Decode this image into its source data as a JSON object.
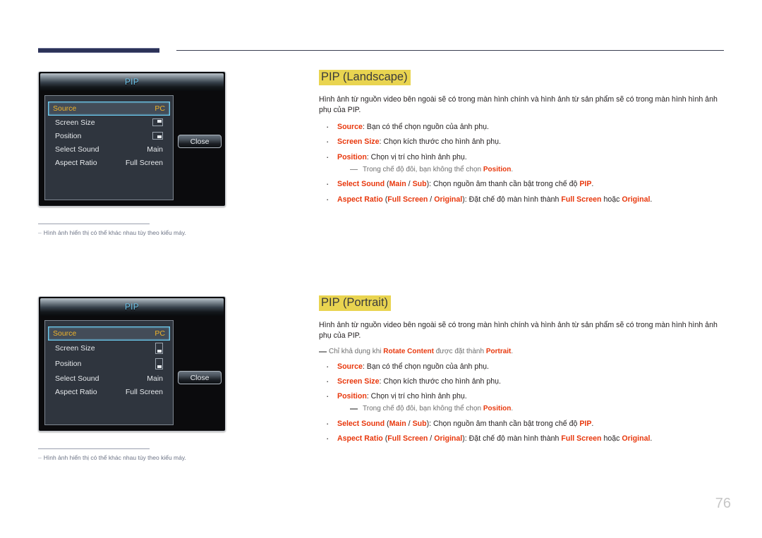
{
  "page": {
    "number": "76"
  },
  "osd": {
    "title": "PIP",
    "close_label": "Close",
    "landscape": {
      "rows": [
        {
          "label": "Source",
          "value": "PC",
          "type": "text",
          "selected": true
        },
        {
          "label": "Screen Size",
          "value": "",
          "type": "icon-landscape-top-right",
          "selected": false
        },
        {
          "label": "Position",
          "value": "",
          "type": "icon-landscape-bottom-right",
          "selected": false
        },
        {
          "label": "Select Sound",
          "value": "Main",
          "type": "text",
          "selected": false
        },
        {
          "label": "Aspect Ratio",
          "value": "Full Screen",
          "type": "text",
          "selected": false
        }
      ]
    },
    "portrait": {
      "rows": [
        {
          "label": "Source",
          "value": "PC",
          "type": "text",
          "selected": true
        },
        {
          "label": "Screen Size",
          "value": "",
          "type": "icon-portrait-bottom-center",
          "selected": false
        },
        {
          "label": "Position",
          "value": "",
          "type": "icon-portrait-bottom-center-2",
          "selected": false
        },
        {
          "label": "Select Sound",
          "value": "Main",
          "type": "text",
          "selected": false
        },
        {
          "label": "Aspect Ratio",
          "value": "Full Screen",
          "type": "text",
          "selected": false
        }
      ]
    }
  },
  "figure_notes": {
    "landscape": "Hình ảnh hiển thị có thể khác nhau tùy theo kiểu máy.",
    "portrait": "Hình ảnh hiển thị có thể khác nhau tùy theo kiểu máy."
  },
  "sections": {
    "landscape": {
      "heading": "PIP (Landscape)",
      "intro": "Hình ảnh từ nguồn video bên ngoài sẽ có trong màn hình chính và hình ảnh từ sản phẩm sẽ có trong màn hình hình ảnh phụ của PIP.",
      "bullets": [
        {
          "term": "Source",
          "rest": ": Bạn có thể chọn nguồn của ảnh phụ."
        },
        {
          "term": "Screen Size",
          "rest": ": Chọn kích thước cho hình ảnh phụ."
        },
        {
          "term": "Position",
          "rest": ": Chọn vị trí cho hình ảnh phụ."
        }
      ],
      "position_note_pre": "Trong chế độ đôi, bạn không thể chọn ",
      "position_note_term": "Position",
      "position_note_post": ".",
      "select_sound": {
        "term": "Select Sound",
        "open": " (",
        "opt1": "Main",
        "sep": " / ",
        "opt2": "Sub",
        "close": "): Chọn nguồn âm thanh cần bật trong chế độ ",
        "pip": "PIP",
        "end": "."
      },
      "aspect_ratio": {
        "term": "Aspect Ratio",
        "open": " (",
        "opt1": "Full Screen",
        "sep": " / ",
        "opt2": "Original",
        "close": "): Đặt chế độ màn hình thành ",
        "val1": "Full Screen",
        "mid": " hoặc ",
        "val2": "Original",
        "end": "."
      }
    },
    "portrait": {
      "heading": "PIP (Portrait)",
      "intro": "Hình ảnh từ nguồn video bên ngoài sẽ có trong màn hình chính và hình ảnh từ sản phẩm sẽ có trong màn hình hình ảnh phụ của PIP.",
      "avail_note_pre": "Chỉ khả dụng khi ",
      "avail_note_term1": "Rotate Content",
      "avail_note_mid": " được đặt thành ",
      "avail_note_term2": "Portrait",
      "avail_note_post": ".",
      "bullets": [
        {
          "term": "Source",
          "rest": ": Bạn có thể chọn nguồn của ảnh phụ."
        },
        {
          "term": "Screen Size",
          "rest": ": Chọn kích thước cho hình ảnh phụ."
        },
        {
          "term": "Position",
          "rest": ": Chọn vị trí cho hình ảnh phụ."
        }
      ],
      "position_note_pre": "Trong chế độ đôi, bạn không thể chọn ",
      "position_note_term": "Position",
      "position_note_post": ".",
      "select_sound": {
        "term": "Select Sound",
        "open": " (",
        "opt1": "Main",
        "sep": " / ",
        "opt2": "Sub",
        "close": "): Chọn nguồn âm thanh cần bật trong chế độ ",
        "pip": "PIP",
        "end": "."
      },
      "aspect_ratio": {
        "term": "Aspect Ratio",
        "open": " (",
        "opt1": "Full Screen",
        "sep": " / ",
        "opt2": "Original",
        "close": "): Đặt chế độ màn hình thành ",
        "val1": "Full Screen",
        "mid": " hoặc ",
        "val2": "Original",
        "end": "."
      }
    }
  },
  "colors": {
    "highlight": "#e9d450",
    "term_red": "#e8380d",
    "osd_select_border": "#6fd0f5",
    "osd_select_text": "#f0b429",
    "header_block": "#2b3157"
  }
}
